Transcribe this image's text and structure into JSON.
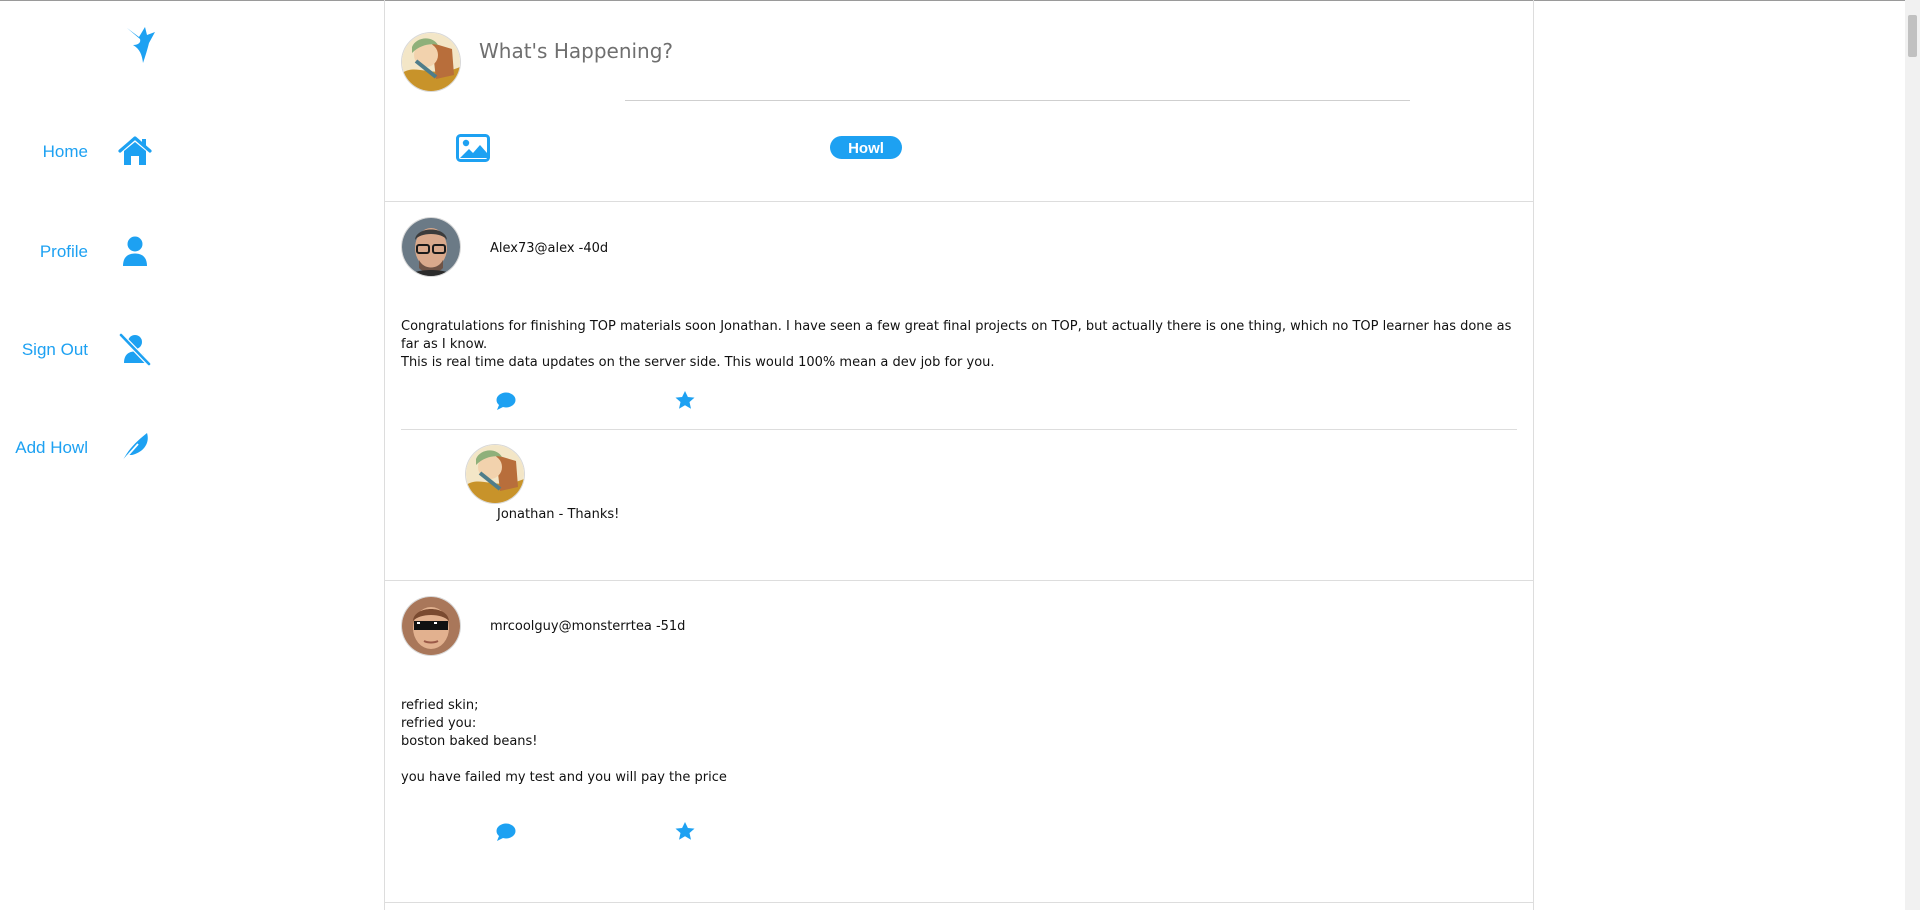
{
  "sidebar": {
    "items": [
      {
        "label": "Home",
        "icon": "home-icon"
      },
      {
        "label": "Profile",
        "icon": "user-icon"
      },
      {
        "label": "Sign Out",
        "icon": "user-slash-icon"
      },
      {
        "label": "Add Howl",
        "icon": "feather-icon"
      }
    ],
    "logo_icon": "bird-logo-icon"
  },
  "composer": {
    "placeholder": "What's Happening?",
    "image_icon": "image-icon",
    "submit_label": "Howl"
  },
  "posts": [
    {
      "header": "Alex73@alex -40d",
      "body": "Congratulations for finishing TOP materials soon Jonathan. I have seen a few great final projects on TOP, but actually there is one thing, which no TOP learner has done as far as I know.\nThis is real time data updates on the server side. This would 100% mean a dev job for you.",
      "reply": "Jonathan - Thanks!"
    },
    {
      "header": "mrcoolguy@monsterrtea -51d",
      "body": "refried skin;\nrefried you:\nboston baked beans!\n\nyou have failed my test and you will pay the price"
    }
  ],
  "colors": {
    "accent": "#1da1f2",
    "border": "#dddddd"
  }
}
